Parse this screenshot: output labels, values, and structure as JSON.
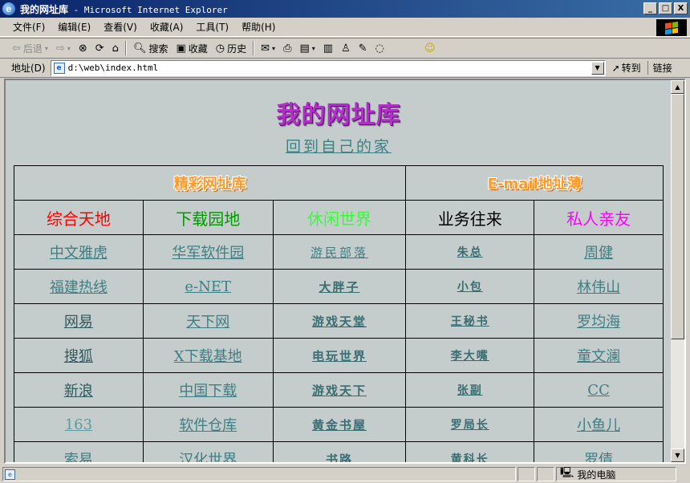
{
  "window": {
    "title_cn": "我的网址库",
    "title_rest": " - Microsoft Internet Explorer",
    "minimize": "_",
    "maximize": "□",
    "close": "X"
  },
  "menubar": [
    "文件(F)",
    "编辑(E)",
    "查看(V)",
    "收藏(A)",
    "工具(T)",
    "帮助(H)"
  ],
  "toolbar": {
    "back": "后退",
    "search": "搜索",
    "favorites": "收藏",
    "history": "历史"
  },
  "addressbar": {
    "label": "地址(D)",
    "url": "d:\\web\\index.html",
    "go": "转到",
    "links": "链接"
  },
  "page": {
    "title": "我的网址库",
    "home_link": "回到自己的家",
    "section_headers": [
      "精彩网址库",
      "E-mail地址薄"
    ],
    "categories": [
      {
        "label": "综合天地",
        "color": "#ff0000"
      },
      {
        "label": "下载园地",
        "color": "#009900"
      },
      {
        "label": "休闲世界",
        "color": "#33ff33"
      },
      {
        "label": "业务往来",
        "color": "#000000"
      },
      {
        "label": "私人亲友",
        "color": "#ff00ff"
      }
    ],
    "rows": [
      [
        "中文雅虎",
        "华军软件园",
        "游民部落",
        "朱总",
        "周健"
      ],
      [
        "福建热线",
        "e-NET",
        "大胖子",
        "小包",
        "林伟山"
      ],
      [
        "网易",
        "天下网",
        "游戏天堂",
        "王秘书",
        "罗均海"
      ],
      [
        "搜狐",
        "X下载基地",
        "电玩世界",
        "李大嘴",
        "童文澜"
      ],
      [
        "新浪",
        "中国下载",
        "游戏天下",
        "张副",
        "CC"
      ],
      [
        "163",
        "软件仓库",
        "黄金书屋",
        "罗局长",
        "小鱼儿"
      ],
      [
        "索易",
        "汉化世界",
        "书路",
        "黄科长",
        "罗倩"
      ]
    ]
  },
  "statusbar": {
    "zone": "我的电脑"
  },
  "icons": {
    "app": "ie-icon",
    "page": "page-icon",
    "computer": "my-computer-icon"
  }
}
